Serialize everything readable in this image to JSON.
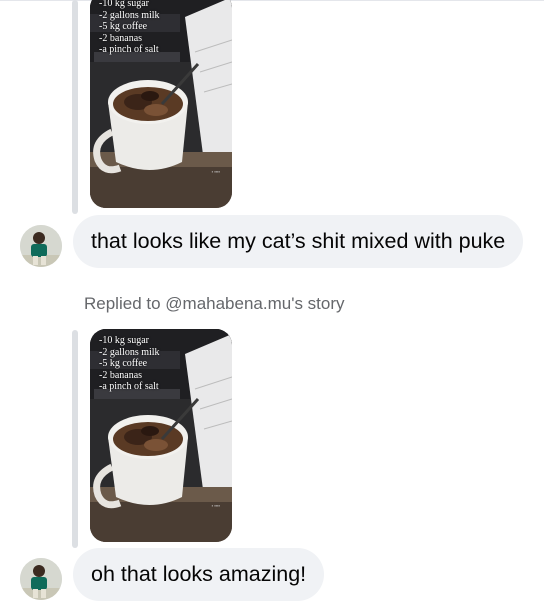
{
  "messages": [
    {
      "story_caption": [
        "-10 kg sugar",
        "-2 gallons milk",
        "-5 kg coffee",
        "-2 bananas",
        "-a pinch of salt"
      ],
      "text": "that looks like my cat’s shit mixed with puke"
    },
    {
      "replied_to": "Replied to @mahabena.mu's story",
      "story_caption": [
        "-10 kg sugar",
        "-2 gallons milk",
        "-5 kg coffee",
        "-2 bananas",
        "-a pinch of salt"
      ],
      "text": "oh that looks amazing!"
    }
  ],
  "colors": {
    "bubble_bg": "#f0f2f5",
    "reply_bar": "#dcdfe3",
    "meta_text": "#65676b"
  }
}
